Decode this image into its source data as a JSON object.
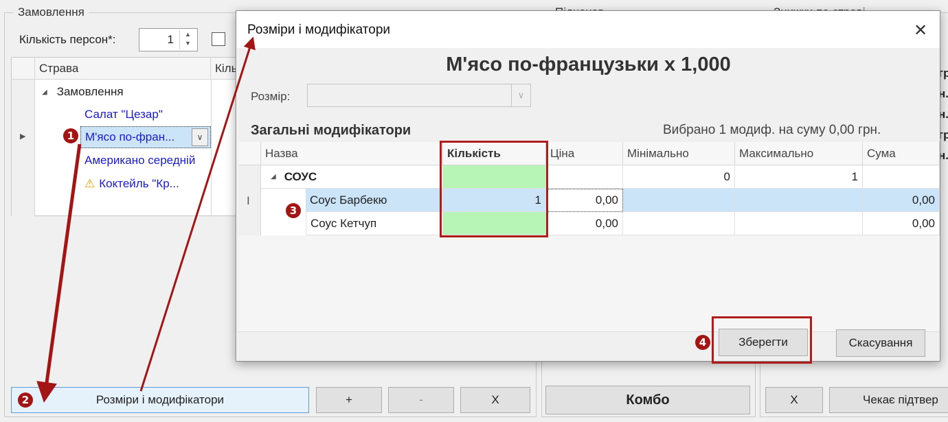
{
  "bg": {
    "order_group": "Замовлення",
    "persons_label": "Кількість персон*:",
    "persons_value": "1",
    "middle_group": "Піднахов",
    "right_group": "Знижки по страві",
    "grid": {
      "col_dish": "Страва",
      "col_qty": "Кіль",
      "rows": [
        "Замовлення",
        "Салат \"Цезар\"",
        "М'ясо по-фран...",
        "Американо середній",
        "Коктейль \"Кр..."
      ]
    },
    "buttons": {
      "sizes": "Розміри і модифікатори",
      "plus": "+",
      "minus": "-",
      "x": "X",
      "combo": "Комбо",
      "x2": "X",
      "awaiting": "Чекає підтвер"
    },
    "right_fragments": [
      "гр",
      "н.",
      "н.",
      "гр",
      "н."
    ]
  },
  "dialog": {
    "title": "Розміри і модифікатори",
    "heading": "М'ясо по-французьки x 1,000",
    "size_label": "Розмір:",
    "section_title": "Загальні модифікатори",
    "summary": "Вибрано 1 модиф. на суму 0,00 грн.",
    "columns": [
      "Назва",
      "Кількість",
      "Ціна",
      "Мінімально",
      "Максимально",
      "Сума"
    ],
    "group_row": {
      "name": "СОУС",
      "min": "0",
      "max": "1"
    },
    "rows": [
      {
        "name": "Соус Барбекю",
        "qty": "1",
        "price": "0,00",
        "sum": "0,00"
      },
      {
        "name": "Соус Кетчуп",
        "qty": "",
        "price": "0,00",
        "sum": "0,00"
      }
    ],
    "save": "Зберегти",
    "cancel": "Скасування"
  },
  "badges": [
    "1",
    "2",
    "3",
    "4"
  ],
  "colors": {
    "accent_red": "#a31515",
    "qty_green": "#b7f5b7",
    "selection": "#cce4f7",
    "link_blue": "#1a1ad0"
  }
}
